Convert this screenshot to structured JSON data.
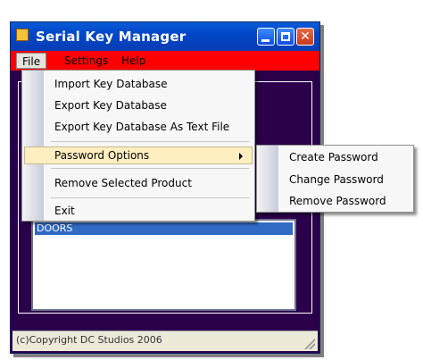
{
  "window": {
    "title": "Serial Key Manager",
    "close_glyph": "✕"
  },
  "menubar": {
    "file": "File",
    "settings": "Settings",
    "help": "Help"
  },
  "file_menu": {
    "items": [
      "Import Key Database",
      "Export Key Database",
      "Export Key Database As Text File",
      "Password Options",
      "Remove Selected Product",
      "Exit"
    ]
  },
  "password_submenu": {
    "items": [
      "Create Password",
      "Change Password",
      "Remove Password"
    ]
  },
  "list": {
    "selected_item": "DOORS"
  },
  "statusbar": {
    "text": "(c)Copyright DC Studios 2006"
  },
  "colors": {
    "menubar_bg": "#ff0000",
    "window_bg": "#2b004b",
    "titlebar": "#0047c8",
    "selection": "#316ac5",
    "menu_highlight": "#ffefc0"
  },
  "icons": {
    "app": "key-app-icon",
    "submenu_indicator": "submenu-arrow-icon"
  }
}
